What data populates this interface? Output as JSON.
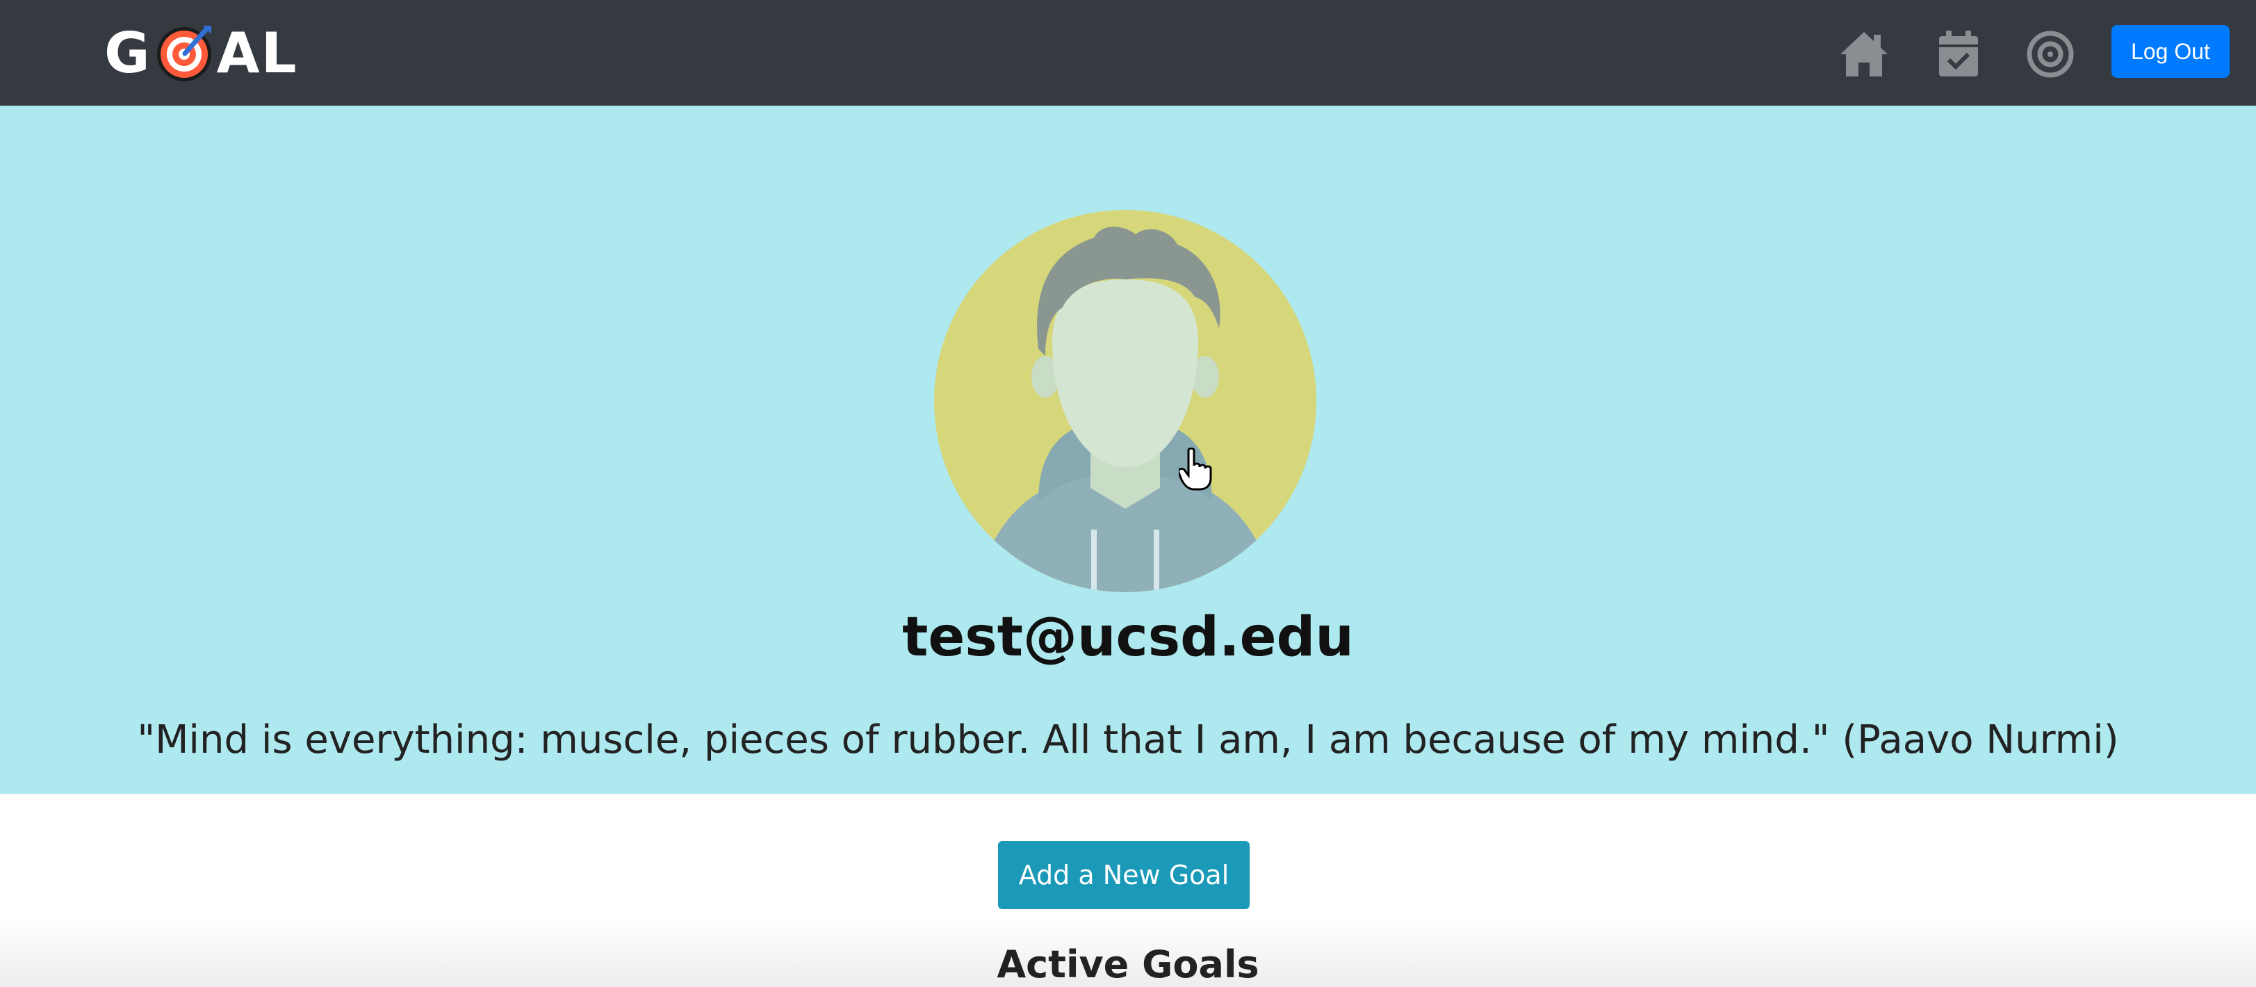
{
  "navbar": {
    "logo_left": "G",
    "logo_right": "AL",
    "icons": [
      "home-icon",
      "calendar-check-icon",
      "target-icon"
    ],
    "logout_label": "Log Out",
    "background": "#343a40",
    "button_color": "#007bff"
  },
  "profile": {
    "email": "test@ucsd.edu",
    "quote": "\"Mind is everything: muscle, pieces of rubber. All that I am, I am because of my mind.\" (Paavo Nurmi)",
    "hero_background": "#aee9f0"
  },
  "actions": {
    "add_goal_label": "Add a New Goal",
    "add_goal_color": "#1a9ab8"
  },
  "sections": {
    "active_goals_title": "Active Goals"
  }
}
